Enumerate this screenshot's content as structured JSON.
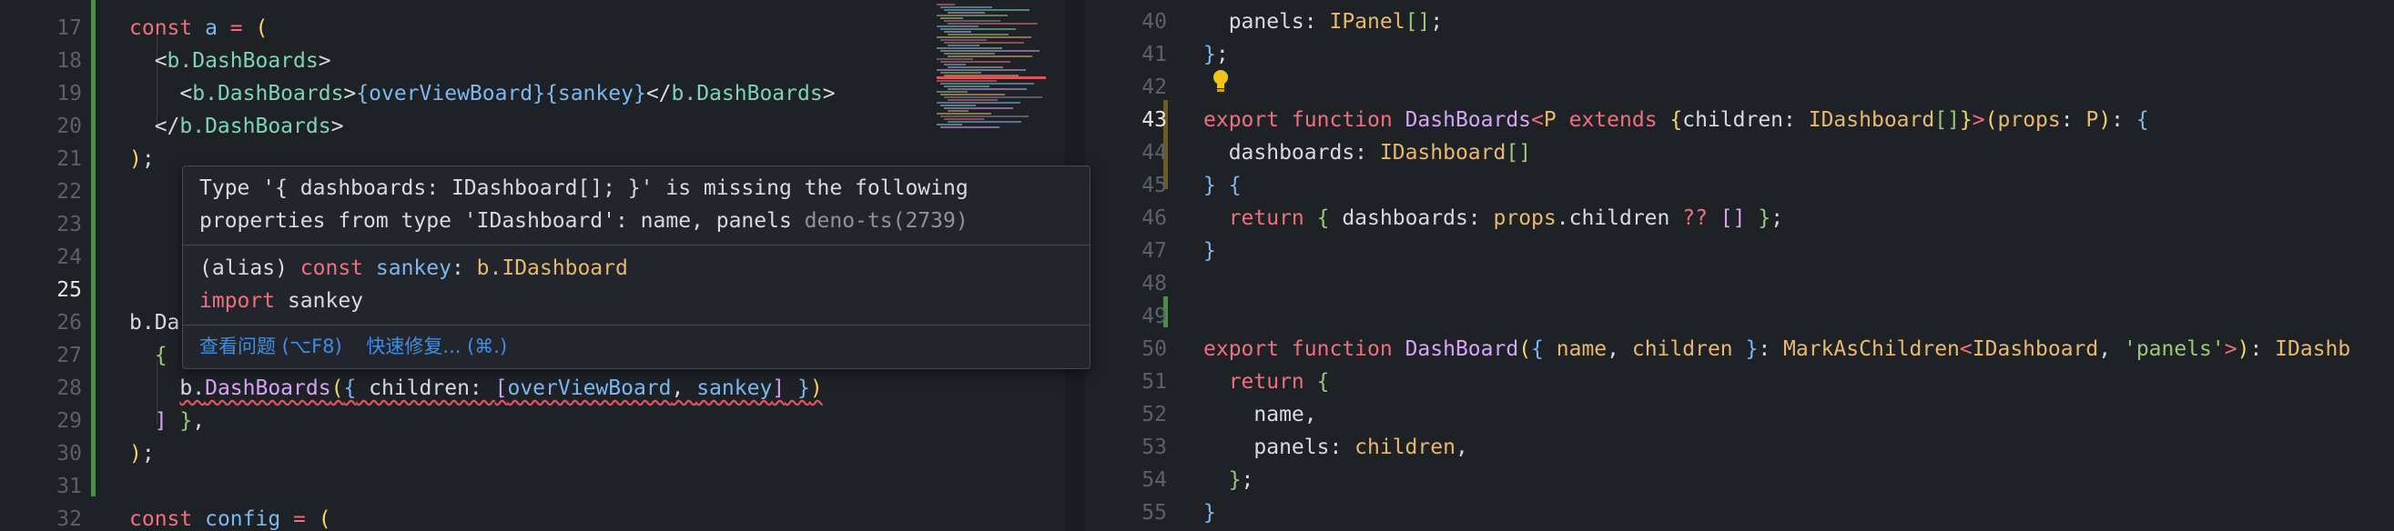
{
  "left_editor": {
    "lines": [
      {
        "n": "17",
        "tokens": [
          {
            "c": "k",
            "t": "const "
          },
          {
            "c": "v",
            "t": "a"
          },
          {
            "c": "k",
            "t": " = "
          },
          {
            "c": "br",
            "t": "("
          }
        ]
      },
      {
        "n": "18",
        "tokens": [
          {
            "c": "pl",
            "t": "  <"
          },
          {
            "c": "tag",
            "t": "b.DashBoards"
          },
          {
            "c": "pl",
            "t": ">"
          }
        ]
      },
      {
        "n": "19",
        "tokens": [
          {
            "c": "pl",
            "t": "    <"
          },
          {
            "c": "tag",
            "t": "b.DashBoards"
          },
          {
            "c": "pl",
            "t": ">"
          },
          {
            "c": "br3",
            "t": "{"
          },
          {
            "c": "v",
            "t": "overViewBoard"
          },
          {
            "c": "br3",
            "t": "}{"
          },
          {
            "c": "v",
            "t": "sankey"
          },
          {
            "c": "br3",
            "t": "}"
          },
          {
            "c": "pl",
            "t": "</"
          },
          {
            "c": "tag",
            "t": "b.DashBoards"
          },
          {
            "c": "pl",
            "t": ">"
          }
        ]
      },
      {
        "n": "20",
        "tokens": [
          {
            "c": "pl",
            "t": "  </"
          },
          {
            "c": "tag",
            "t": "b.DashBoards"
          },
          {
            "c": "pl",
            "t": ">"
          }
        ]
      },
      {
        "n": "21",
        "tokens": [
          {
            "c": "br",
            "t": ")"
          },
          {
            "c": "pl",
            "t": ";"
          }
        ]
      },
      {
        "n": "22",
        "tokens": []
      },
      {
        "n": "23",
        "tokens": []
      },
      {
        "n": "24",
        "tokens": []
      },
      {
        "n": "25",
        "tokens": []
      },
      {
        "n": "26",
        "tokens": [
          {
            "c": "pl",
            "t": "b.Da"
          }
        ]
      },
      {
        "n": "27",
        "tokens": [
          {
            "c": "br2",
            "t": "  {"
          }
        ]
      },
      {
        "n": "28",
        "tokens": [
          {
            "c": "pl",
            "t": "    "
          },
          {
            "c": "pl err",
            "t": "b."
          },
          {
            "c": "f err",
            "t": "DashBoards"
          },
          {
            "c": "br err",
            "t": "("
          },
          {
            "c": "br3 err",
            "t": "{"
          },
          {
            "c": "pl err",
            "t": " children: "
          },
          {
            "c": "f err",
            "t": "["
          },
          {
            "c": "v err",
            "t": "overViewBoard"
          },
          {
            "c": "pl err",
            "t": ", "
          },
          {
            "c": "v err",
            "t": "sankey"
          },
          {
            "c": "f err",
            "t": "]"
          },
          {
            "c": "br3 err",
            "t": " }"
          },
          {
            "c": "br err",
            "t": ")"
          }
        ]
      },
      {
        "n": "29",
        "tokens": [
          {
            "c": "f",
            "t": "  ]"
          },
          {
            "c": "br2",
            "t": " }"
          },
          {
            "c": "pl",
            "t": ","
          }
        ]
      },
      {
        "n": "30",
        "tokens": [
          {
            "c": "br",
            "t": ")"
          },
          {
            "c": "pl",
            "t": ";"
          }
        ]
      },
      {
        "n": "31",
        "tokens": []
      },
      {
        "n": "32",
        "tokens": [
          {
            "c": "k",
            "t": "const "
          },
          {
            "c": "v",
            "t": "config"
          },
          {
            "c": "k",
            "t": " = "
          },
          {
            "c": "br",
            "t": "("
          }
        ]
      }
    ],
    "active_line": "25"
  },
  "hover": {
    "message_line1": "Type '{ dashboards: IDashboard[]; }' is missing the following",
    "message_line2": "properties from type 'IDashboard': name, panels ",
    "source": "deno-ts(2739)",
    "type_line1_tokens": [
      {
        "c": "pl",
        "t": "(alias) "
      },
      {
        "c": "k",
        "t": "const "
      },
      {
        "c": "v",
        "t": "sankey"
      },
      {
        "c": "pl",
        "t": ": "
      },
      {
        "c": "t",
        "t": "b.IDashboard"
      }
    ],
    "type_line2_tokens": [
      {
        "c": "k",
        "t": "import "
      },
      {
        "c": "pl",
        "t": "sankey"
      }
    ],
    "action_view_problem": "查看问题 (⌥F8)",
    "action_quick_fix": "快速修复... (⌘.)"
  },
  "right_editor": {
    "lines": [
      {
        "n": "40",
        "tokens": [
          {
            "c": "pl",
            "t": "  panels: "
          },
          {
            "c": "t",
            "t": "IPanel"
          },
          {
            "c": "br2",
            "t": "[]"
          },
          {
            "c": "pl",
            "t": ";"
          }
        ]
      },
      {
        "n": "41",
        "tokens": [
          {
            "c": "br3",
            "t": "}"
          },
          {
            "c": "pl",
            "t": ";"
          }
        ]
      },
      {
        "n": "42",
        "tokens": []
      },
      {
        "n": "43",
        "tokens": [
          {
            "c": "k",
            "t": "export function "
          },
          {
            "c": "f",
            "t": "DashBoards"
          },
          {
            "c": "k",
            "t": "<"
          },
          {
            "c": "t",
            "t": "P"
          },
          {
            "c": "k",
            "t": " extends "
          },
          {
            "c": "br",
            "t": "{"
          },
          {
            "c": "pl",
            "t": "children: "
          },
          {
            "c": "t",
            "t": "IDashboard"
          },
          {
            "c": "br2",
            "t": "[]"
          },
          {
            "c": "br",
            "t": "}"
          },
          {
            "c": "k",
            "t": ">"
          },
          {
            "c": "br",
            "t": "("
          },
          {
            "c": "t",
            "t": "props"
          },
          {
            "c": "pl",
            "t": ": "
          },
          {
            "c": "t",
            "t": "P"
          },
          {
            "c": "br",
            "t": ")"
          },
          {
            "c": "pl",
            "t": ": "
          },
          {
            "c": "br3",
            "t": "{"
          }
        ]
      },
      {
        "n": "44",
        "tokens": [
          {
            "c": "pl",
            "t": "  dashboards: "
          },
          {
            "c": "t",
            "t": "IDashboard"
          },
          {
            "c": "br2",
            "t": "[]"
          }
        ]
      },
      {
        "n": "45",
        "tokens": [
          {
            "c": "br3",
            "t": "}"
          },
          {
            "c": "pl",
            "t": " "
          },
          {
            "c": "br3",
            "t": "{"
          }
        ]
      },
      {
        "n": "46",
        "tokens": [
          {
            "c": "k",
            "t": "  return "
          },
          {
            "c": "br2",
            "t": "{"
          },
          {
            "c": "pl",
            "t": " dashboards: "
          },
          {
            "c": "t",
            "t": "props"
          },
          {
            "c": "pl",
            "t": ".children "
          },
          {
            "c": "k",
            "t": "??"
          },
          {
            "c": "pl",
            "t": " "
          },
          {
            "c": "f",
            "t": "[]"
          },
          {
            "c": "br2",
            "t": " }"
          },
          {
            "c": "pl",
            "t": ";"
          }
        ]
      },
      {
        "n": "47",
        "tokens": [
          {
            "c": "br3",
            "t": "}"
          }
        ]
      },
      {
        "n": "48",
        "tokens": []
      },
      {
        "n": "49",
        "tokens": []
      },
      {
        "n": "50",
        "tokens": [
          {
            "c": "k",
            "t": "export function "
          },
          {
            "c": "f",
            "t": "DashBoard"
          },
          {
            "c": "br",
            "t": "("
          },
          {
            "c": "br3",
            "t": "{"
          },
          {
            "c": "pl",
            "t": " "
          },
          {
            "c": "t",
            "t": "name"
          },
          {
            "c": "pl",
            "t": ", "
          },
          {
            "c": "t",
            "t": "children"
          },
          {
            "c": "br3",
            "t": " }"
          },
          {
            "c": "pl",
            "t": ": "
          },
          {
            "c": "t",
            "t": "MarkAsChildren"
          },
          {
            "c": "k",
            "t": "<"
          },
          {
            "c": "t",
            "t": "IDashboard"
          },
          {
            "c": "pl",
            "t": ", "
          },
          {
            "c": "s",
            "t": "'panels'"
          },
          {
            "c": "k",
            "t": ">"
          },
          {
            "c": "br",
            "t": ")"
          },
          {
            "c": "pl",
            "t": ": "
          },
          {
            "c": "t",
            "t": "IDashb"
          }
        ]
      },
      {
        "n": "51",
        "tokens": [
          {
            "c": "k",
            "t": "  return "
          },
          {
            "c": "br2",
            "t": "{"
          }
        ]
      },
      {
        "n": "52",
        "tokens": [
          {
            "c": "pl",
            "t": "    name,"
          }
        ]
      },
      {
        "n": "53",
        "tokens": [
          {
            "c": "pl",
            "t": "    panels: "
          },
          {
            "c": "t",
            "t": "children"
          },
          {
            "c": "pl",
            "t": ","
          }
        ]
      },
      {
        "n": "54",
        "tokens": [
          {
            "c": "br2",
            "t": "  }"
          },
          {
            "c": "pl",
            "t": ";"
          }
        ]
      },
      {
        "n": "55",
        "tokens": [
          {
            "c": "br3",
            "t": "}"
          }
        ]
      }
    ],
    "active_line": "43"
  }
}
